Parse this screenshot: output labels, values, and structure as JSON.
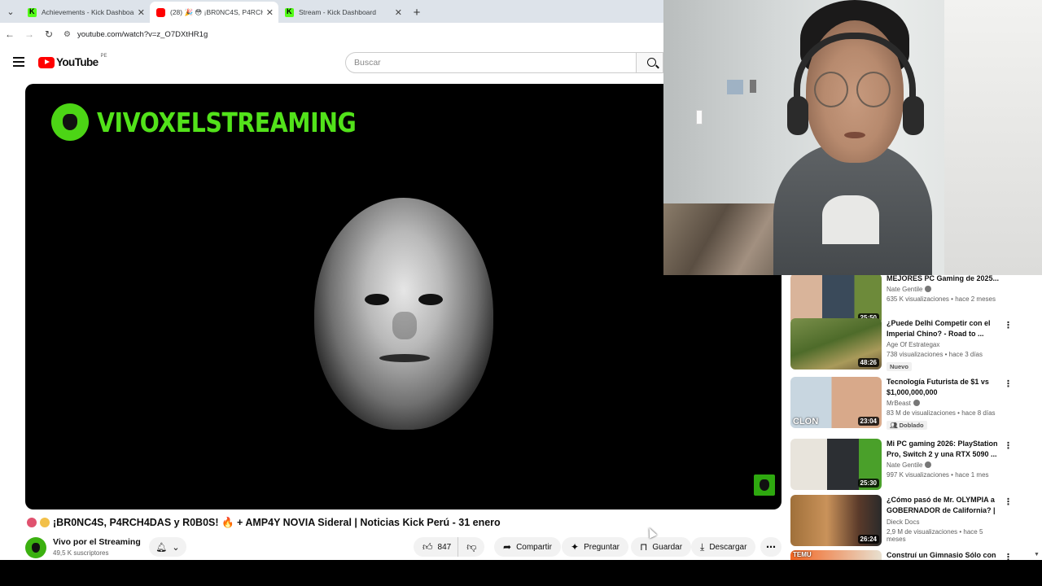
{
  "browser": {
    "tabs": [
      {
        "title": "Achievements - Kick Dashboard",
        "favicon": "kick"
      },
      {
        "title": "(28) 🎉 😳 ¡BR0NC4S, P4RCH4...",
        "favicon": "youtube"
      },
      {
        "title": "Stream - Kick Dashboard",
        "favicon": "kick"
      }
    ],
    "url": "youtube.com/watch?v=z_O7DXtHR1g"
  },
  "youtube": {
    "logo_text": "YouTube",
    "country": "PE",
    "search_placeholder": "Buscar"
  },
  "player": {
    "overlay_brand": "VIVOXELSTREAMING"
  },
  "video": {
    "title": "¡BR0NC4S, P4RCH4DAS y R0B0S! 🔥 + AMP4Y NOVIA Sideral | Noticias Kick Perú - 31 enero",
    "channel_name": "Vivo por el Streaming",
    "subscribers": "49,5 K suscriptores",
    "likes": "847",
    "actions": {
      "share": "Compartir",
      "ask": "Preguntar",
      "save": "Guardar",
      "download": "Descargar"
    }
  },
  "recommendations": [
    {
      "title": "MEJORES PC Gaming de 2025...",
      "channel": "Nate Gentile",
      "verified": true,
      "views": "635 K visualizaciones",
      "age": "hace 2 meses",
      "duration": "25:50",
      "badge": ""
    },
    {
      "title": "¿Puede Delhi Competir con el Imperial Chino? - Road to ...",
      "channel": "Age Of Estrategax",
      "verified": false,
      "views": "738 visualizaciones",
      "age": "hace 3 días",
      "duration": "48:26",
      "badge": "Nuevo"
    },
    {
      "title": "Tecnología Futurista de $1 vs $1,000,000,000",
      "channel": "MrBeast",
      "verified": true,
      "views": "83 M de visualizaciones",
      "age": "hace 8 días",
      "duration": "23:04",
      "badge": "Doblado",
      "thumb_text": "CLON"
    },
    {
      "title": "Mi PC gaming 2026: PlayStation Pro, Switch 2 y una RTX 5090 ...",
      "channel": "Nate Gentile",
      "verified": true,
      "views": "997 K visualizaciones",
      "age": "hace 1 mes",
      "duration": "25:30",
      "badge": ""
    },
    {
      "title": "¿Cómo pasó de Mr. OLYMPIA a GOBERNADOR de California? | ...",
      "channel": "Dieck Docs",
      "verified": false,
      "views": "2,9 M de visualizaciones",
      "age": "hace 5 meses",
      "duration": "26:24",
      "badge": ""
    },
    {
      "title": "Construí un Gimnasio Sólo con",
      "channel": "",
      "verified": false,
      "views": "",
      "age": "",
      "duration": "",
      "badge": "",
      "thumb_text": "TEMU"
    }
  ],
  "colors": {
    "kick_green": "#53fc18",
    "youtube_red": "#ff0000"
  }
}
